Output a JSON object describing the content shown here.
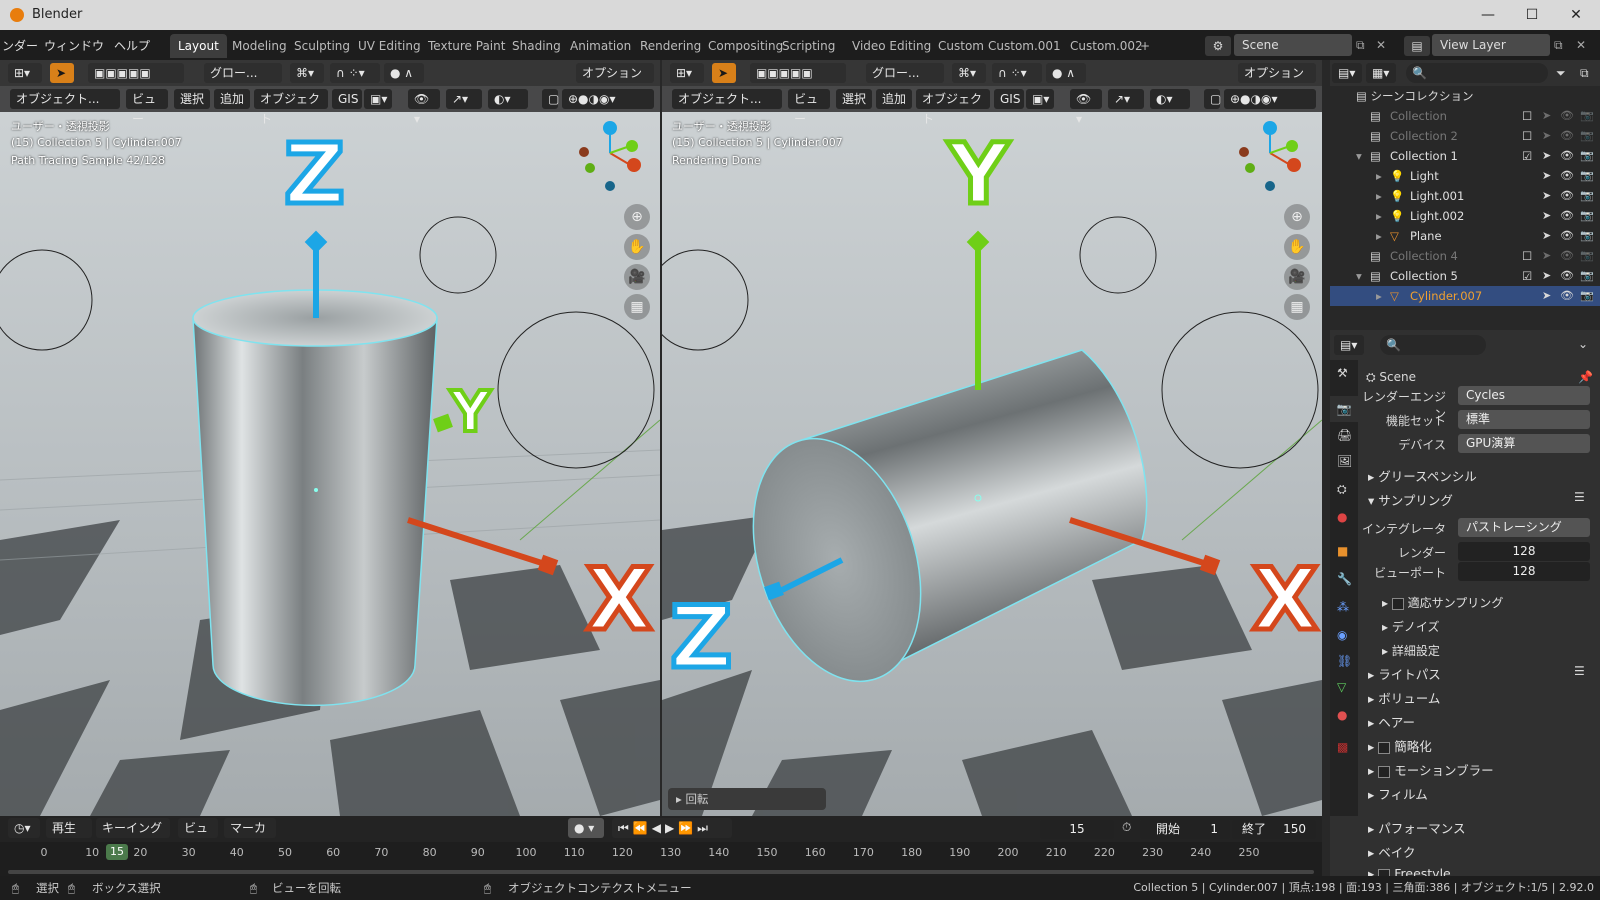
{
  "window": {
    "title": "Blender",
    "minimize": "—",
    "maximize": "☐",
    "close": "✕"
  },
  "menu": [
    "ンダー",
    "ウィンドウ",
    "ヘルプ"
  ],
  "workspaces": [
    "Layout",
    "Modeling",
    "Sculpting",
    "UV Editing",
    "Texture Paint",
    "Shading",
    "Animation",
    "Rendering",
    "Compositing",
    "Scripting",
    "Video Editing",
    "Custom",
    "Custom.001",
    "Custom.002",
    "+"
  ],
  "scene": {
    "name": "Scene",
    "view_layer": "View Layer"
  },
  "viewport_left": {
    "header": {
      "transform": "グロー...",
      "options": "オプション"
    },
    "header2": {
      "mode": "オブジェクト...",
      "view": "ビュー",
      "select": "選択",
      "add": "追加",
      "object": "オブジェクト",
      "gis": "GIS"
    },
    "overlay": [
      "ユーザー・透視投影",
      "(15) Collection 5 | Cylinder.007",
      "Path Tracing Sample 42/128"
    ],
    "axes": {
      "z": "Z",
      "y": "Y",
      "x": "X"
    }
  },
  "viewport_right": {
    "header": {
      "transform": "グロー...",
      "options": "オプション"
    },
    "header2": {
      "mode": "オブジェクト...",
      "view": "ビュー",
      "select": "選択",
      "add": "追加",
      "object": "オブジェクト",
      "gis": "GIS"
    },
    "overlay": [
      "ユーザー・透視投影",
      "(15) Collection 5 | Cylinder.007",
      "Rendering Done"
    ],
    "axes": {
      "z": "Z",
      "y": "Y",
      "x": "X"
    },
    "operator_panel": "回転"
  },
  "outliner": {
    "root": "シーンコレクション",
    "items": [
      {
        "label": "Collection",
        "dim": true
      },
      {
        "label": "Collection 2",
        "dim": true
      },
      {
        "label": "Collection 1",
        "dim": false
      },
      {
        "label": "Light",
        "dim": false
      },
      {
        "label": "Light.001",
        "dim": false
      },
      {
        "label": "Light.002",
        "dim": false
      },
      {
        "label": "Plane",
        "dim": false
      },
      {
        "label": "Collection 4",
        "dim": true
      },
      {
        "label": "Collection 5",
        "dim": false
      },
      {
        "label": "Cylinder.007",
        "dim": false,
        "selected": true
      }
    ]
  },
  "properties": {
    "context": "Scene",
    "render_engine_label": "レンダーエンジン",
    "render_engine": "Cycles",
    "feature_set_label": "機能セット",
    "feature_set": "標準",
    "device_label": "デバイス",
    "device": "GPU演算",
    "sections": {
      "grease_pencil": "グリースペンシル",
      "sampling": "サンプリング",
      "integrator_label": "インテグレータ",
      "integrator": "パストレーシング",
      "render_label": "レンダー",
      "render_samples": "128",
      "viewport_label": "ビューポート",
      "viewport_samples": "128",
      "adaptive": "適応サンプリング",
      "denoise": "デノイズ",
      "advanced": "詳細設定",
      "light_paths": "ライトパス",
      "volumes": "ボリューム",
      "hair": "ヘアー",
      "simplify": "簡略化",
      "motion_blur": "モーションブラー",
      "film": "フィルム",
      "performance": "パフォーマンス",
      "bake": "ベイク",
      "freestyle": "Freestyle"
    }
  },
  "timeline": {
    "play": "再生",
    "keying": "キーイング",
    "view": "ビュー",
    "marker": "マーカー",
    "current_frame": "15",
    "start_label": "開始",
    "start": "1",
    "end_label": "終了",
    "end": "150",
    "ticks": [
      "0",
      "10",
      "20",
      "30",
      "40",
      "50",
      "60",
      "70",
      "80",
      "90",
      "100",
      "110",
      "120",
      "130",
      "140",
      "150",
      "160",
      "170",
      "180",
      "190",
      "200",
      "210",
      "220",
      "230",
      "240",
      "250"
    ]
  },
  "statusbar": {
    "select": "選択",
    "box_select": "ボックス選択",
    "rotate_view": "ビューを回転",
    "context_menu": "オブジェクトコンテクストメニュー",
    "info": "Collection 5 | Cylinder.007 | 頂点:198 | 面:193 | 三角面:386 | オブジェクト:1/5 | 2.92.0"
  },
  "colors": {
    "accent": "#4772b3",
    "x_axis": "#d4471c",
    "y_axis": "#6fcf17",
    "z_axis": "#1ca6e6",
    "selected_row": "#334d80"
  }
}
